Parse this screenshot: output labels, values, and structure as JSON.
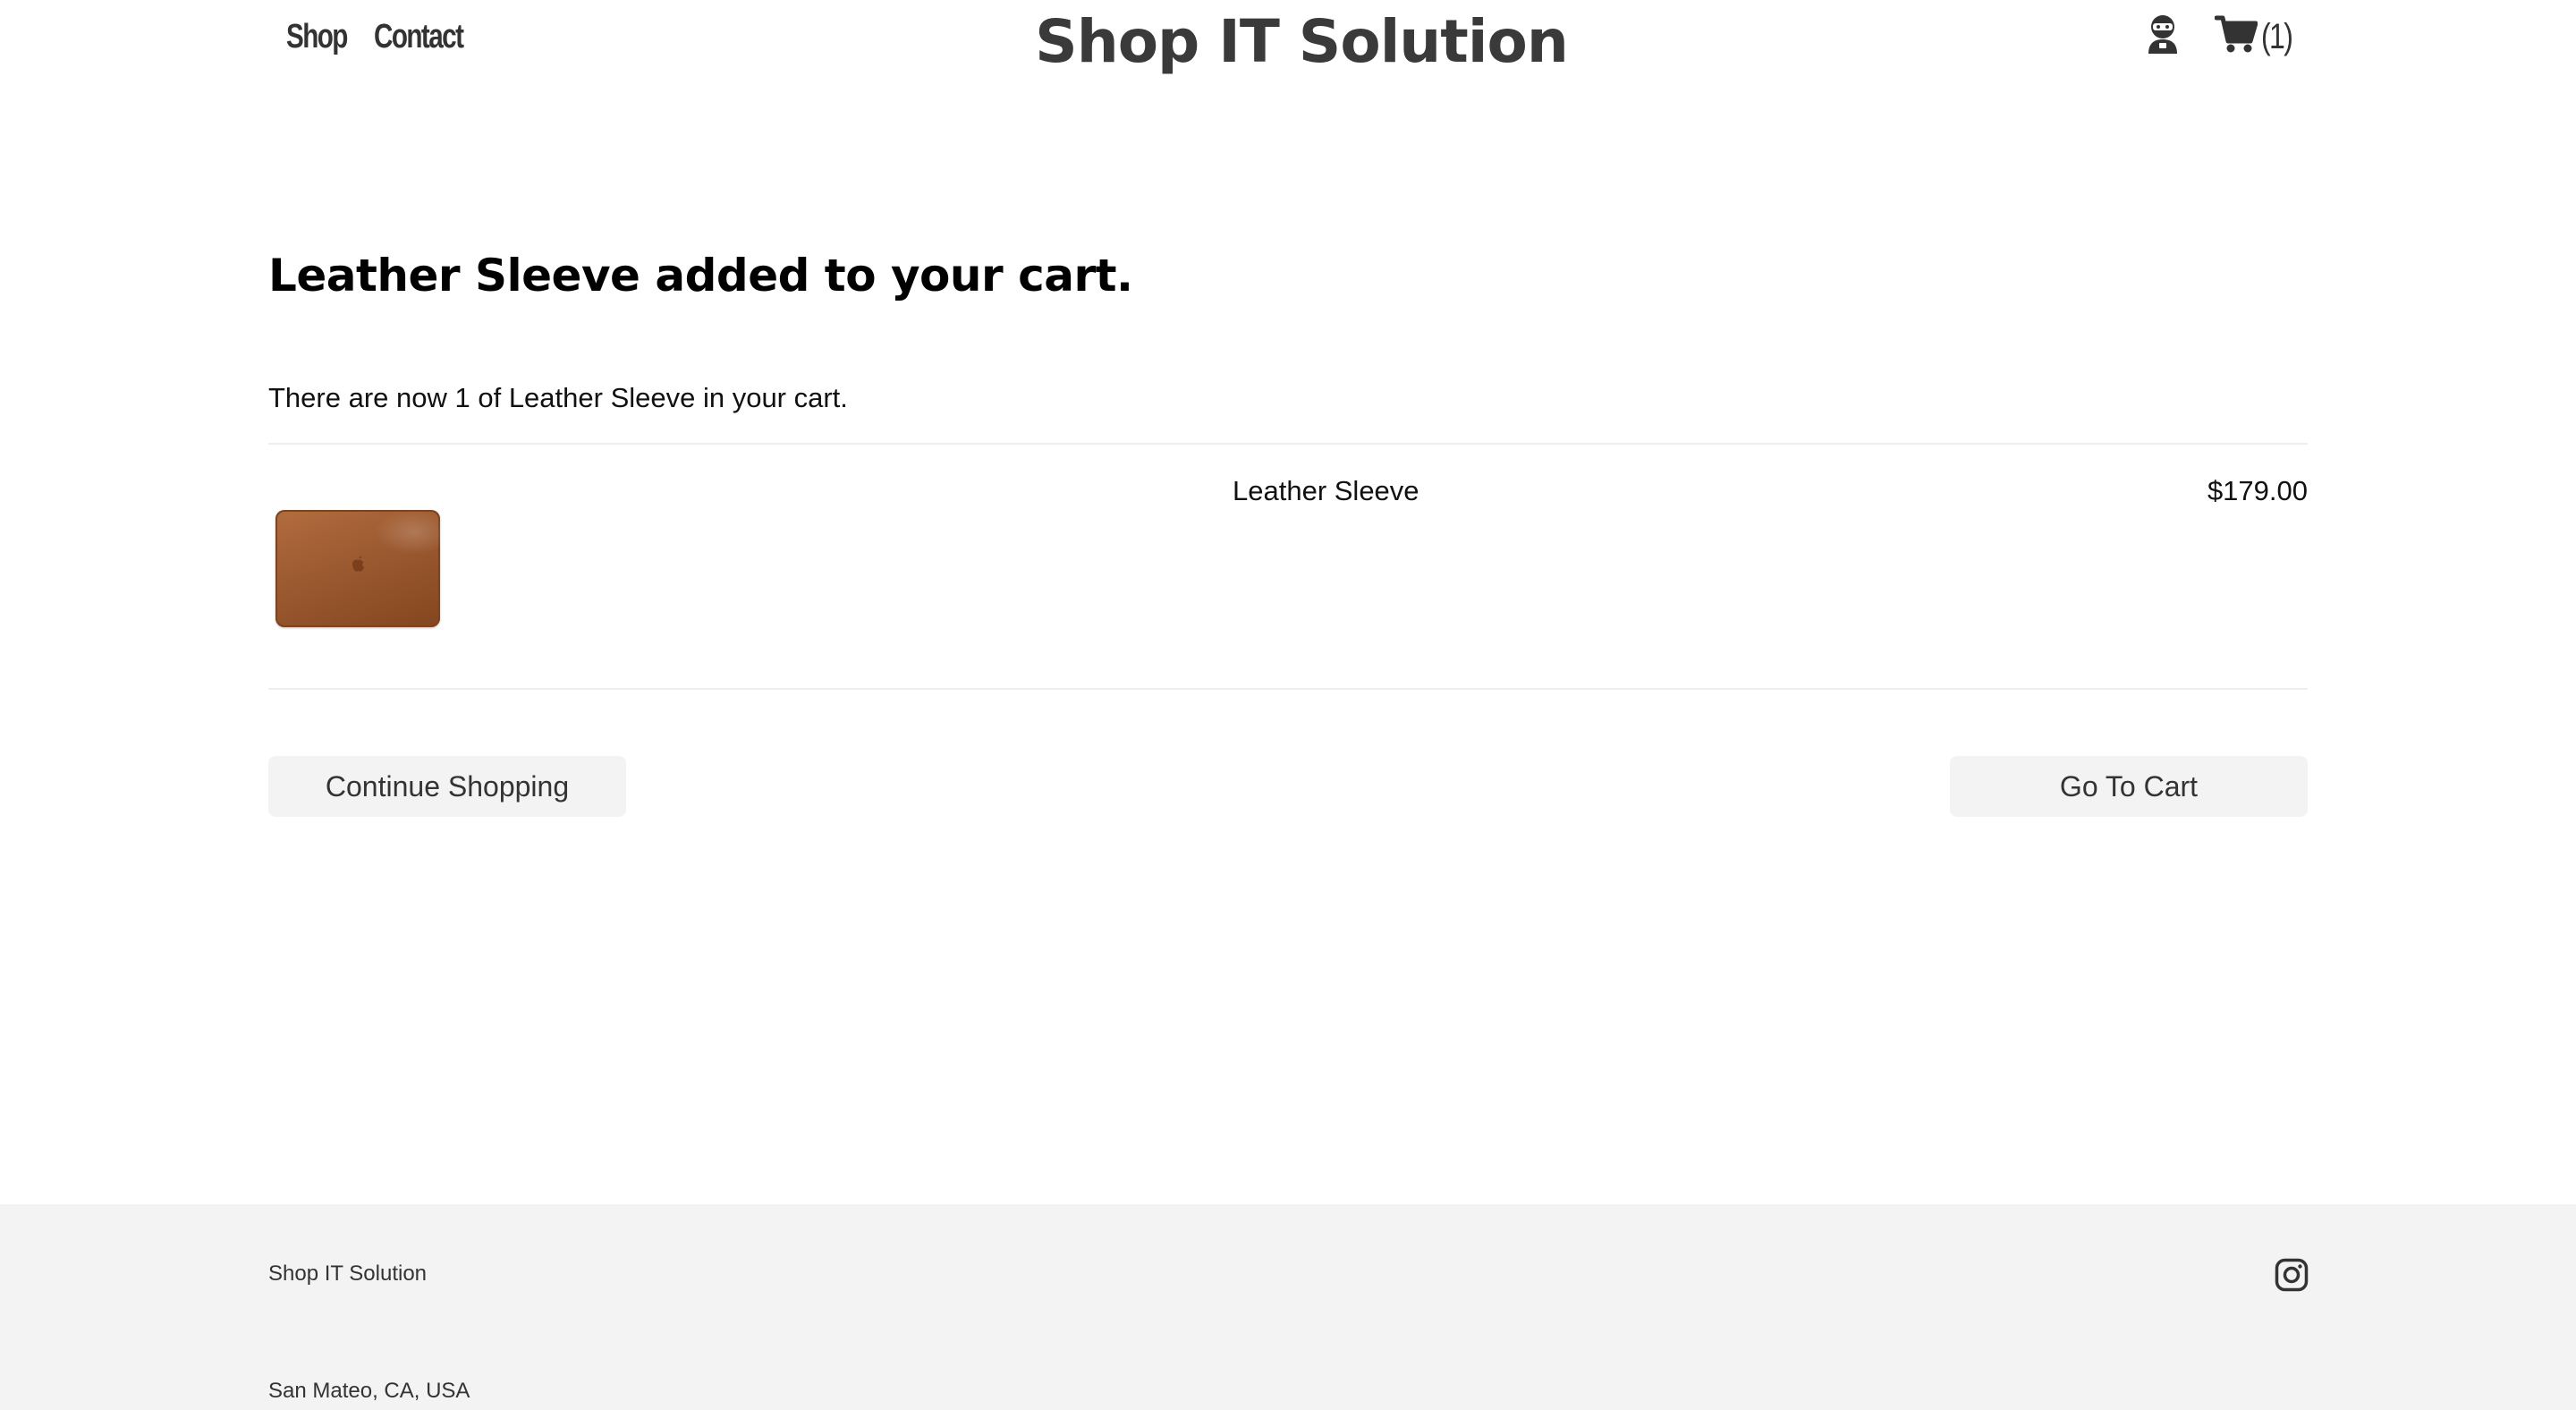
{
  "header": {
    "nav": [
      {
        "label": "Shop"
      },
      {
        "label": "Contact"
      }
    ],
    "site_title": "Shop IT Solution",
    "account_icon": "account-icon",
    "cart_icon": "cart-icon",
    "cart_count": "(1)"
  },
  "main": {
    "headline": "Leather Sleeve added to your cart.",
    "cart_status": "There are now 1 of Leather Sleeve in your cart.",
    "item": {
      "name": "Leather Sleeve",
      "price": "$179.00",
      "thumbnail_color": "#9c5a30"
    },
    "continue_label": "Continue Shopping",
    "go_to_cart_label": "Go To Cart"
  },
  "footer": {
    "brand": "Shop IT Solution",
    "location": "San Mateo, CA, USA",
    "social_icon": "instagram-icon"
  },
  "colors": {
    "title": "#3a3a3a",
    "button_bg": "#f3f3f3",
    "footer_bg": "#f3f3f3",
    "divider": "#eeeeee"
  }
}
